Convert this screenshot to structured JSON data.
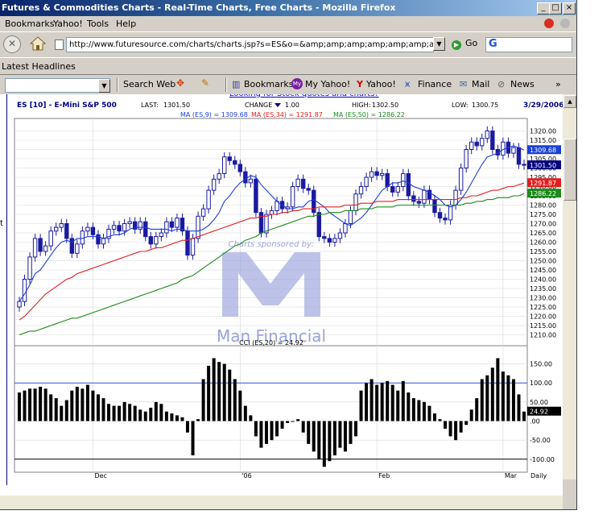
{
  "window": {
    "title": "Futures & Commodities Charts - Real-Time Charts, Free Charts - Mozilla Firefox"
  },
  "menu": [
    "Bookmarks",
    "Yahoo!",
    "Tools",
    "Help"
  ],
  "nav": {
    "url": "http://www.futuresource.com/charts/charts.jsp?s=ES&o=&amp;amp;amp;amp;amp;amp;amp;amp;a=C",
    "go_label": "Go",
    "search_engine_letter": "G"
  },
  "bookmarks_bar": {
    "item": "Latest Headlines"
  },
  "yahoo_toolbar": {
    "items": [
      "Search Web",
      "Bookmarks",
      "My Yahoo!",
      "Yahoo!",
      "Finance",
      "Mail",
      "News"
    ],
    "more": "»"
  },
  "page": {
    "promo_link": "Looking for Stock quotes and charts?",
    "left_edge_char": "t"
  },
  "quote": {
    "symbol_label": "ES [10] - E-Mini S&P 500",
    "last_label": "LAST:",
    "last": "1301.50",
    "change_label": "CHANGE",
    "change": "1.00",
    "high_label": "HIGH:",
    "high": "1302.50",
    "low_label": "LOW:",
    "low": "1300.75",
    "date": "3/29/2006"
  },
  "legend": [
    {
      "text": "MA (ES,9) = 1309.68",
      "color": "#1a3fd8"
    },
    {
      "text": "MA (ES,34) = 1291.87",
      "color": "#e02020"
    },
    {
      "text": "MA (ES,50) = 1286.22",
      "color": "#1c8a1c"
    }
  ],
  "watermark": {
    "sponsor_text": "Charts sponsored by:",
    "brand": "Man Financial",
    "color": "#9aa3dc"
  },
  "cci_label": "CCI (ES,20) = 24.92",
  "frequency": "Daily",
  "colors": {
    "candle": "#1a1aa0",
    "ma9": "#1a3fd8",
    "ma34": "#e02020",
    "ma50": "#1c8a1c",
    "cci_bar": "#000000",
    "cci_line": "#3050e0"
  },
  "chart_data": [
    {
      "type": "candlestick",
      "title": "ES [10] - E-Mini S&P 500",
      "x_labels": [
        "Dec",
        "'06",
        "Feb",
        "Mar"
      ],
      "ylim": [
        1205,
        1325
      ],
      "y_ticks": [
        1210,
        1215,
        1220,
        1225,
        1230,
        1235,
        1240,
        1245,
        1250,
        1255,
        1260,
        1265,
        1270,
        1275,
        1280,
        1285,
        1290,
        1295,
        1300,
        1305,
        1310,
        1315,
        1320
      ],
      "price_tags": [
        {
          "value": 1309.68,
          "label": "1309.68",
          "color": "#1a3fd8"
        },
        {
          "value": 1301.5,
          "label": "1301.50",
          "color": "#000080"
        },
        {
          "value": 1291.87,
          "label": "1291.87",
          "color": "#e02020"
        },
        {
          "value": 1286.22,
          "label": "1286.22",
          "color": "#1c8a1c"
        }
      ],
      "close": [
        1228,
        1240,
        1252,
        1262,
        1255,
        1258,
        1266,
        1268,
        1270,
        1262,
        1254,
        1259,
        1266,
        1268,
        1264,
        1259,
        1262,
        1267,
        1269,
        1266,
        1270,
        1271,
        1267,
        1271,
        1263,
        1259,
        1263,
        1265,
        1271,
        1268,
        1273,
        1266,
        1253,
        1262,
        1274,
        1278,
        1288,
        1294,
        1297,
        1306,
        1304,
        1302,
        1298,
        1292,
        1294,
        1276,
        1265,
        1275,
        1277,
        1282,
        1278,
        1279,
        1290,
        1294,
        1289,
        1288,
        1276,
        1263,
        1262,
        1260,
        1262,
        1265,
        1270,
        1277,
        1286,
        1290,
        1295,
        1298,
        1296,
        1297,
        1290,
        1287,
        1290,
        1297,
        1285,
        1282,
        1281,
        1288,
        1283,
        1276,
        1273,
        1272,
        1280,
        1288,
        1300,
        1310,
        1314,
        1312,
        1316,
        1320,
        1310,
        1307,
        1314,
        1308,
        1311,
        1302,
        1301.5
      ],
      "series": [
        {
          "name": "MA (ES,9)",
          "last": 1309.68,
          "values": [
            1228,
            1232,
            1237,
            1243,
            1245,
            1249,
            1253,
            1257,
            1260,
            1261,
            1260,
            1262,
            1262,
            1263,
            1263,
            1263,
            1262,
            1263,
            1264,
            1264,
            1265,
            1267,
            1268,
            1268,
            1268,
            1267,
            1267,
            1267,
            1267,
            1266,
            1267,
            1267,
            1266,
            1266,
            1266,
            1267,
            1269,
            1272,
            1276,
            1282,
            1285,
            1289,
            1292,
            1294,
            1296,
            1295,
            1291,
            1288,
            1285,
            1282,
            1280,
            1278,
            1278,
            1279,
            1279,
            1282,
            1283,
            1281,
            1279,
            1276,
            1274,
            1272,
            1270,
            1269,
            1271,
            1273,
            1276,
            1280,
            1284,
            1288,
            1290,
            1292,
            1292,
            1293,
            1292,
            1290,
            1289,
            1288,
            1287,
            1285,
            1283,
            1280,
            1279,
            1280,
            1283,
            1287,
            1292,
            1297,
            1302,
            1306,
            1307,
            1308,
            1310,
            1311,
            1312,
            1311,
            1309.68
          ]
        },
        {
          "name": "MA (ES,34)",
          "last": 1291.87,
          "values": [
            1218,
            1220,
            1223,
            1226,
            1229,
            1232,
            1234,
            1236,
            1238,
            1240,
            1241,
            1243,
            1244,
            1245,
            1246,
            1247,
            1248,
            1249,
            1250,
            1251,
            1252,
            1253,
            1254,
            1255,
            1255,
            1256,
            1257,
            1257,
            1258,
            1259,
            1260,
            1261,
            1261,
            1262,
            1263,
            1264,
            1265,
            1266,
            1267,
            1268,
            1269,
            1270,
            1271,
            1272,
            1273,
            1273,
            1274,
            1274,
            1275,
            1275,
            1276,
            1276,
            1277,
            1277,
            1278,
            1278,
            1278,
            1279,
            1279,
            1279,
            1279,
            1279,
            1280,
            1280,
            1280,
            1281,
            1281,
            1281,
            1282,
            1282,
            1282,
            1282,
            1283,
            1283,
            1283,
            1283,
            1283,
            1283,
            1283,
            1283,
            1283,
            1283,
            1283,
            1283,
            1284,
            1284,
            1285,
            1285,
            1286,
            1287,
            1288,
            1288,
            1289,
            1290,
            1290,
            1291,
            1291.87
          ]
        },
        {
          "name": "MA (ES,50)",
          "last": 1286.22,
          "values": [
            1210,
            1211,
            1212,
            1212,
            1213,
            1214,
            1215,
            1216,
            1217,
            1218,
            1219,
            1219,
            1220,
            1221,
            1222,
            1223,
            1224,
            1225,
            1226,
            1227,
            1228,
            1229,
            1230,
            1231,
            1232,
            1233,
            1234,
            1235,
            1236,
            1237,
            1238,
            1240,
            1241,
            1242,
            1244,
            1246,
            1248,
            1250,
            1252,
            1254,
            1256,
            1258,
            1259,
            1261,
            1262,
            1263,
            1265,
            1266,
            1267,
            1268,
            1269,
            1270,
            1271,
            1272,
            1273,
            1274,
            1274,
            1275,
            1275,
            1276,
            1276,
            1276,
            1277,
            1277,
            1277,
            1278,
            1278,
            1278,
            1279,
            1279,
            1279,
            1279,
            1280,
            1280,
            1280,
            1280,
            1280,
            1280,
            1280,
            1280,
            1280,
            1280,
            1280,
            1280,
            1280,
            1281,
            1281,
            1282,
            1282,
            1283,
            1283,
            1284,
            1284,
            1284,
            1285,
            1285,
            1286.22
          ]
        }
      ]
    },
    {
      "type": "bar",
      "title": "CCI (ES,20) = 24.92",
      "ylim": [
        -130,
        185
      ],
      "y_ticks": [
        150,
        100,
        50,
        0,
        -50,
        -100
      ],
      "y_tick_labels": [
        "150.00",
        "100.00",
        "50.00",
        ".00",
        "-50.00",
        "-100.00"
      ],
      "reference_lines": [
        100,
        -100
      ],
      "last": 24.92,
      "last_label": "24.92",
      "values": [
        75,
        80,
        85,
        85,
        90,
        85,
        70,
        60,
        40,
        55,
        80,
        90,
        85,
        95,
        80,
        70,
        60,
        45,
        40,
        40,
        50,
        45,
        40,
        30,
        25,
        35,
        50,
        45,
        25,
        20,
        15,
        10,
        -30,
        -90,
        5,
        110,
        145,
        165,
        155,
        150,
        135,
        110,
        80,
        40,
        15,
        -40,
        -70,
        -60,
        -50,
        -40,
        -20,
        -5,
        0,
        5,
        -30,
        -60,
        -80,
        -100,
        -120,
        -105,
        -90,
        -70,
        -80,
        -60,
        -40,
        80,
        100,
        110,
        95,
        100,
        105,
        95,
        80,
        105,
        75,
        60,
        55,
        50,
        40,
        20,
        5,
        -20,
        -40,
        -50,
        -30,
        -10,
        30,
        60,
        110,
        120,
        140,
        165,
        130,
        120,
        110,
        70,
        24.92
      ]
    }
  ]
}
